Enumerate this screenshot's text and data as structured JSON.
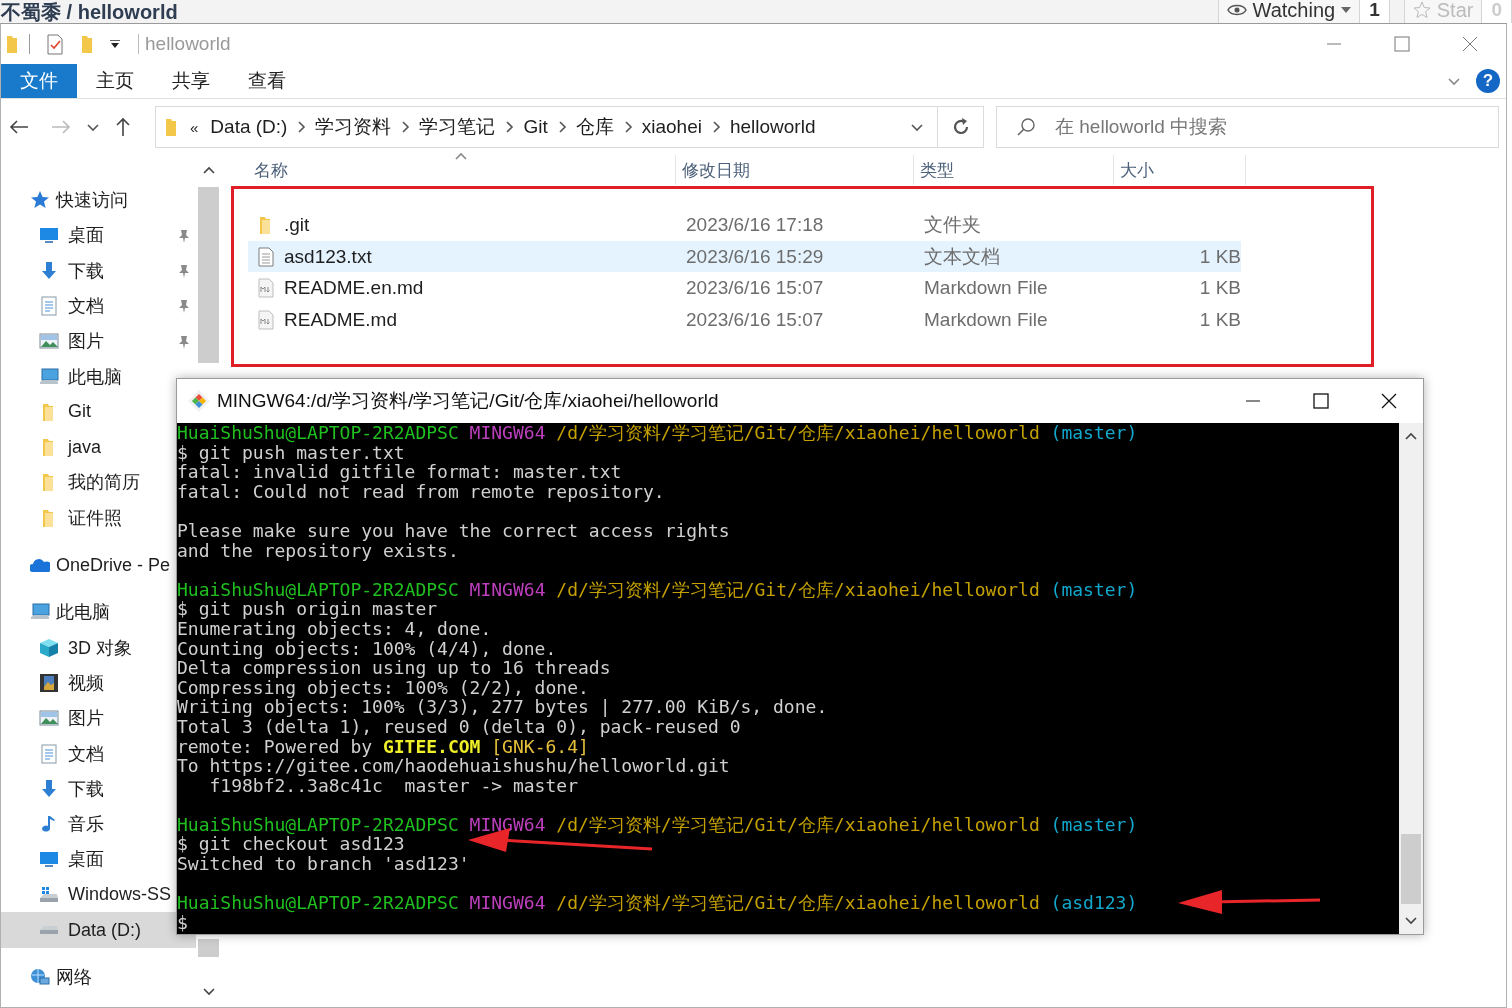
{
  "page_header": {
    "title": "不蜀黍 / helloworld",
    "watch": {
      "label": "Watching",
      "count": "1"
    },
    "star": {
      "label": "Star",
      "count": "0"
    }
  },
  "explorer": {
    "title": "helloworld",
    "ribbon_tabs": [
      {
        "label": "文件",
        "selected": true
      },
      {
        "label": "主页",
        "selected": false
      },
      {
        "label": "共享",
        "selected": false
      },
      {
        "label": "查看",
        "selected": false
      }
    ],
    "help": "?",
    "address": {
      "prefix": "«",
      "crumbs": [
        "Data (D:)",
        "学习资料",
        "学习笔记",
        "Git",
        "仓库",
        "xiaohei",
        "helloworld"
      ]
    },
    "search": {
      "placeholder": "在 helloworld 中搜索"
    },
    "sidebar": {
      "items": [
        {
          "label": "快速访问",
          "kind": "quick_access",
          "selected": false,
          "children": [
            {
              "label": "桌面",
              "kind": "desktop",
              "pinned": true,
              "selected": false
            },
            {
              "label": "下载",
              "kind": "downloads",
              "pinned": true,
              "selected": false
            },
            {
              "label": "文档",
              "kind": "documents",
              "pinned": true,
              "selected": false
            },
            {
              "label": "图片",
              "kind": "pictures",
              "pinned": true,
              "selected": false
            },
            {
              "label": "此电脑",
              "kind": "pc",
              "pinned": false,
              "selected": false
            },
            {
              "label": "Git",
              "kind": "folder",
              "pinned": false,
              "selected": false
            },
            {
              "label": "java",
              "kind": "folder",
              "pinned": false,
              "selected": false
            },
            {
              "label": "我的简历",
              "kind": "folder",
              "pinned": false,
              "selected": false
            },
            {
              "label": "证件照",
              "kind": "folder",
              "pinned": false,
              "selected": false
            }
          ]
        },
        {
          "label": "OneDrive - Pe",
          "kind": "onedrive",
          "selected": false
        },
        {
          "label": "此电脑",
          "kind": "pc",
          "selected": false,
          "children": [
            {
              "label": "3D 对象",
              "kind": "objects3d",
              "pinned": false,
              "selected": false
            },
            {
              "label": "视频",
              "kind": "videos",
              "pinned": false,
              "selected": false
            },
            {
              "label": "图片",
              "kind": "pictures",
              "pinned": false,
              "selected": false
            },
            {
              "label": "文档",
              "kind": "documents",
              "pinned": false,
              "selected": false
            },
            {
              "label": "下载",
              "kind": "downloads",
              "pinned": false,
              "selected": false
            },
            {
              "label": "音乐",
              "kind": "music",
              "pinned": false,
              "selected": false
            },
            {
              "label": "桌面",
              "kind": "desktop",
              "pinned": false,
              "selected": false
            },
            {
              "label": "Windows-SS",
              "kind": "windows_drive",
              "pinned": false,
              "selected": false
            },
            {
              "label": "Data (D:)",
              "kind": "drive",
              "pinned": false,
              "selected": true
            }
          ]
        },
        {
          "label": "网络",
          "kind": "network",
          "selected": false
        }
      ]
    },
    "table": {
      "columns": [
        "名称",
        "修改日期",
        "类型",
        "大小"
      ],
      "rows": [
        {
          "name": ".git",
          "kind": "folder",
          "modified": "2023/6/16 17:18",
          "type": "文件夹",
          "selected": false
        },
        {
          "name": "asd123.txt",
          "kind": "text",
          "modified": "2023/6/16 15:29",
          "type": "文本文档",
          "size": "1 KB",
          "selected": true
        },
        {
          "name": "README.en.md",
          "kind": "markdown",
          "modified": "2023/6/16 15:07",
          "type": "Markdown File",
          "size": "1 KB",
          "selected": false
        },
        {
          "name": "README.md",
          "kind": "markdown",
          "modified": "2023/6/16 15:07",
          "type": "Markdown File",
          "size": "1 KB",
          "selected": false
        }
      ]
    }
  },
  "terminal": {
    "title": "MINGW64:/d/学习资料/学习笔记/Git/仓库/xiaohei/helloworld",
    "blocks": [
      [
        [
          {
            "text": "HuaiShuShu@LAPTOP-2R2ADPSC ",
            "kind": "user"
          },
          {
            "text": "MINGW64 ",
            "kind": "shell"
          },
          {
            "text": "/d/学习资料/学习笔记/Git/仓库/xiaohei/helloworld ",
            "kind": "path"
          },
          {
            "text": "(master)",
            "kind": "branch"
          }
        ],
        [
          {
            "text": "$ git push master.txt",
            "kind": "plain"
          }
        ],
        [
          {
            "text": "fatal: invalid gitfile format: master.txt",
            "kind": "plain"
          }
        ],
        [
          {
            "text": "fatal: Could not read from remote repository.",
            "kind": "plain"
          }
        ]
      ],
      [
        [
          {
            "text": "Please make sure you have the correct access rights",
            "kind": "plain"
          }
        ],
        [
          {
            "text": "and the repository exists.",
            "kind": "plain"
          }
        ]
      ],
      [
        [
          {
            "text": "HuaiShuShu@LAPTOP-2R2ADPSC ",
            "kind": "user"
          },
          {
            "text": "MINGW64 ",
            "kind": "shell"
          },
          {
            "text": "/d/学习资料/学习笔记/Git/仓库/xiaohei/helloworld ",
            "kind": "path"
          },
          {
            "text": "(master)",
            "kind": "branch"
          }
        ],
        [
          {
            "text": "$ git push origin master",
            "kind": "plain"
          }
        ],
        [
          {
            "text": "Enumerating objects: 4, done.",
            "kind": "plain"
          }
        ],
        [
          {
            "text": "Counting objects: 100% (4/4), done.",
            "kind": "plain"
          }
        ],
        [
          {
            "text": "Delta compression using up to 16 threads",
            "kind": "plain"
          }
        ],
        [
          {
            "text": "Compressing objects: 100% (2/2), done.",
            "kind": "plain"
          }
        ],
        [
          {
            "text": "Writing objects: 100% (3/3), 277 bytes | 277.00 KiB/s, done.",
            "kind": "plain"
          }
        ],
        [
          {
            "text": "Total 3 (delta 1), reused 0 (delta 0), pack-reused 0",
            "kind": "plain"
          }
        ],
        [
          {
            "text": "remote: Powered by ",
            "kind": "plain"
          },
          {
            "text": "GITEE.COM ",
            "kind": "brand"
          },
          {
            "text": "[GNK-6.4]",
            "kind": "tag"
          }
        ],
        [
          {
            "text": "To https://gitee.com/haodehuaishushu/helloworld.git",
            "kind": "plain"
          }
        ],
        [
          {
            "text": "   f198bf2..3a8c41c  master -> master",
            "kind": "plain"
          }
        ]
      ],
      [
        [
          {
            "text": "HuaiShuShu@LAPTOP-2R2ADPSC ",
            "kind": "user"
          },
          {
            "text": "MINGW64 ",
            "kind": "shell"
          },
          {
            "text": "/d/学习资料/学习笔记/Git/仓库/xiaohei/helloworld ",
            "kind": "path"
          },
          {
            "text": "(master)",
            "kind": "branch"
          }
        ],
        [
          {
            "text": "$ git checkout asd123",
            "kind": "plain"
          }
        ],
        [
          {
            "text": "Switched to branch 'asd123'",
            "kind": "plain"
          }
        ]
      ],
      [
        [
          {
            "text": "HuaiShuShu@LAPTOP-2R2ADPSC ",
            "kind": "user"
          },
          {
            "text": "MINGW64 ",
            "kind": "shell"
          },
          {
            "text": "/d/学习资料/学习笔记/Git/仓库/xiaohei/helloworld ",
            "kind": "path"
          },
          {
            "text": "(asd123)",
            "kind": "branch"
          }
        ],
        [
          {
            "text": "$",
            "kind": "plain"
          }
        ]
      ]
    ]
  }
}
